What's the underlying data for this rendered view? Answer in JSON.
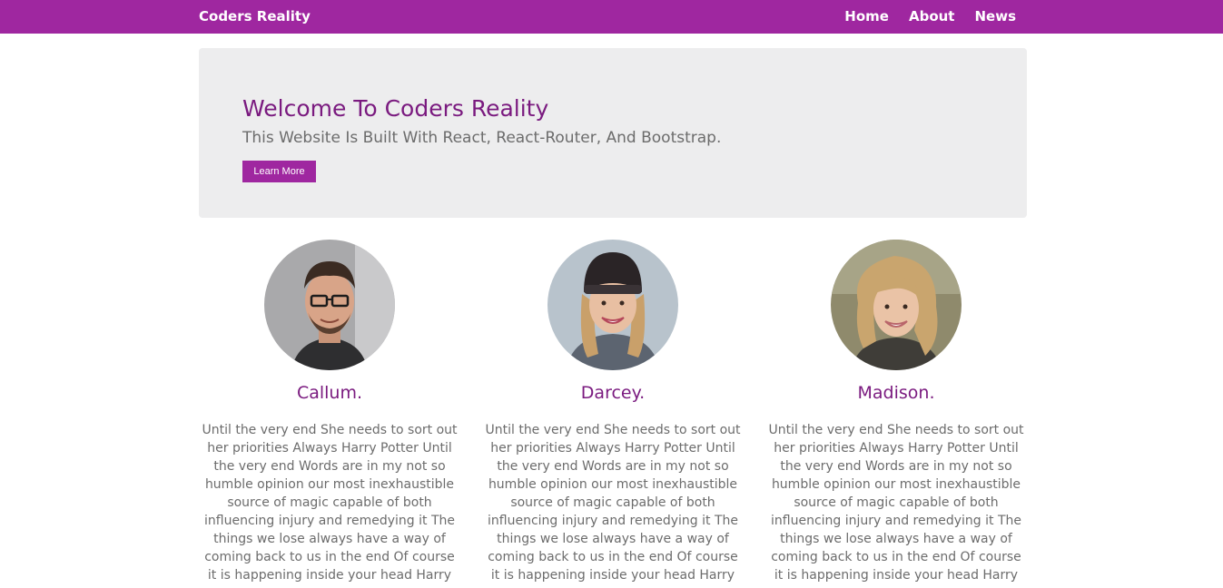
{
  "nav": {
    "brand": "Coders Reality",
    "links": [
      "Home",
      "About",
      "News"
    ]
  },
  "hero": {
    "title": "Welcome To Coders Reality",
    "subtitle": "This Website Is Built With React, React-Router, And Bootstrap.",
    "button_label": "Learn More"
  },
  "team": [
    {
      "name": "Callum.",
      "bio": "Until the very end She needs to sort out her priorities Always Harry Potter Until the very end Words are in my not so humble opinion our most inexhaustible source of magic capable of both influencing injury and remedying it The things we lose always have a way of coming back to us in the end Of course it is happening inside your head Harry"
    },
    {
      "name": "Darcey.",
      "bio": "Until the very end She needs to sort out her priorities Always Harry Potter Until the very end Words are in my not so humble opinion our most inexhaustible source of magic capable of both influencing injury and remedying it The things we lose always have a way of coming back to us in the end Of course it is happening inside your head Harry"
    },
    {
      "name": "Madison.",
      "bio": "Until the very end She needs to sort out her priorities Always Harry Potter Until the very end Words are in my not so humble opinion our most inexhaustible source of magic capable of both influencing injury and remedying it The things we lose always have a way of coming back to us in the end Of course it is happening inside your head Harry"
    }
  ],
  "colors": {
    "brand_purple": "#9f27a0",
    "heading_purple": "#7a1a7f",
    "hero_background": "#ededee",
    "body_text": "#6c6c6c"
  }
}
